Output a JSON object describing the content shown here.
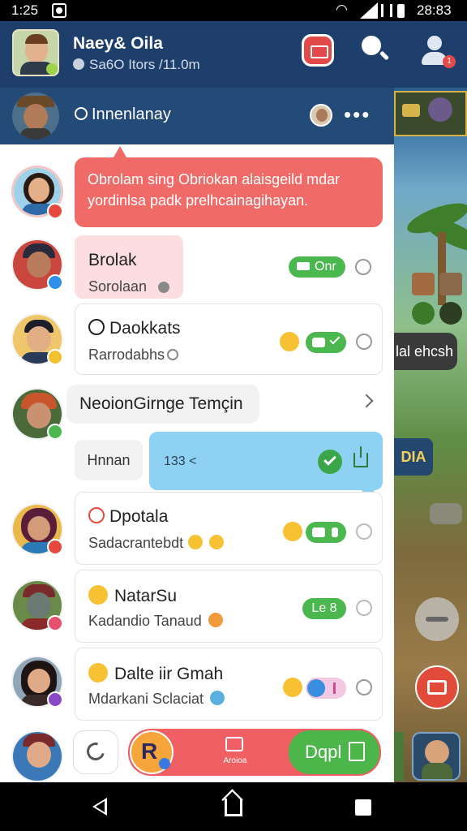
{
  "status_bar": {
    "time": "1:25",
    "clock": "28:83"
  },
  "header": {
    "name": "Naey& Oila",
    "subtitle": "Sa6O Itors /11.0m",
    "notification_count": "1"
  },
  "group": {
    "name": "Innenlanay"
  },
  "messages": {
    "pinned": "Obrolam sing Obriokan alaisgeild mdar yordinlsa padk prelhcainagihayan.",
    "chat1": {
      "title": "Brolak",
      "subtitle": "Sorolaan",
      "pill": "Onr"
    },
    "chat2": {
      "title": "Daokkats",
      "subtitle": "Rarrodabhs"
    },
    "chat3": {
      "title": "NeoionGirnge Temçin"
    },
    "reply_left": "Hnnan",
    "reply_blue": "133 <",
    "chat4": {
      "title": "Dpotala",
      "subtitle": "Sadacrantebdt"
    },
    "chat5": {
      "title": "NatarSu",
      "subtitle": "Kadandio Tanaud",
      "pill": "Le 8"
    },
    "chat6": {
      "title": "Dalte iir Gmah",
      "subtitle": "Mdarkani Sclaciat"
    }
  },
  "bottom_bar": {
    "middle_label": "Aroioa",
    "right_label": "Dqpl"
  },
  "game": {
    "side_label": "lal ehcsh",
    "side_button": "DIA"
  },
  "colors": {
    "accent": "#f06a67",
    "green": "#4bb84f",
    "blue": "#8fd1f2",
    "header": "#1e3f6b"
  }
}
